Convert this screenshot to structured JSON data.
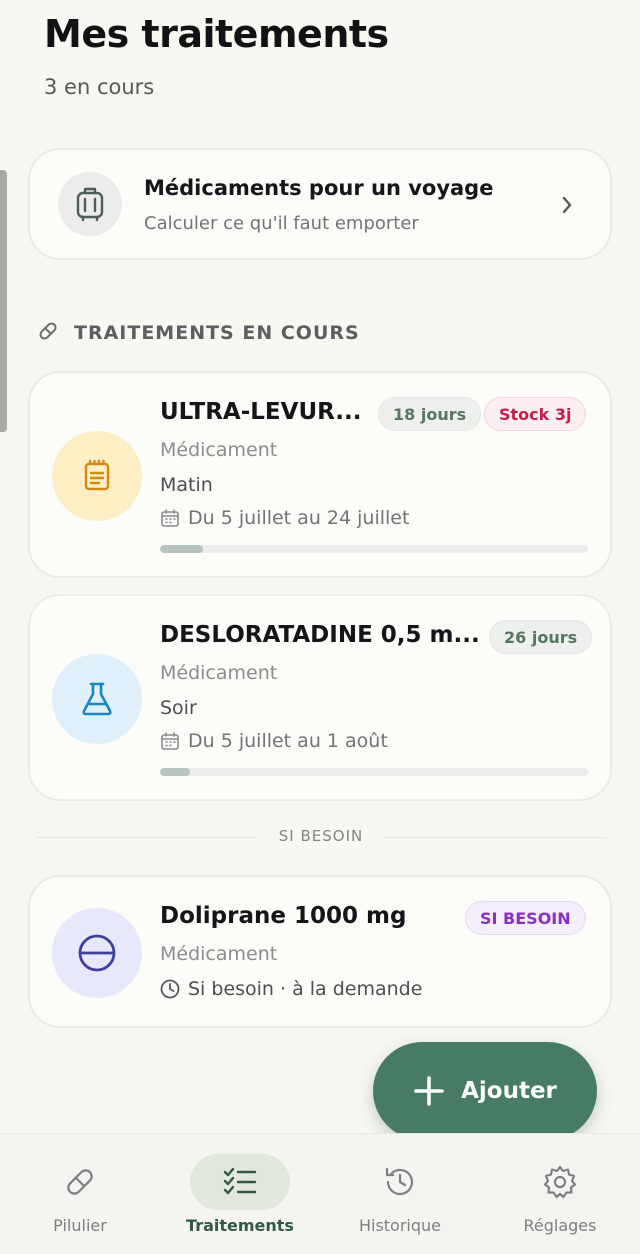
{
  "header": {
    "title": "Mes traitements",
    "subtitle": "3 en cours"
  },
  "travel_card": {
    "title": "Médicaments pour un voyage",
    "subtitle": "Calculer ce qu'il faut emporter",
    "icon": "luggage-icon"
  },
  "sections": {
    "ongoing_label": "TRAITEMENTS EN COURS",
    "as_needed_label": "SI BESOIN"
  },
  "treatments": [
    {
      "name": "ULTRA-LEVUR...",
      "type": "Médicament",
      "time": "Matin",
      "dates": "Du 5 juillet au 24 juillet",
      "days_badge": "18 jours",
      "stock_badge": "Stock 3j",
      "progress": 0.1,
      "icon": "notepad-icon"
    },
    {
      "name": "DESLORATADINE 0,5 m...",
      "type": "Médicament",
      "time": "Soir",
      "dates": "Du 5 juillet au 1 août",
      "days_badge": "26 jours",
      "progress": 0.07,
      "icon": "flask-icon"
    }
  ],
  "as_needed": {
    "name": "Doliprane 1000 mg",
    "type": "Médicament",
    "schedule": "Si besoin · à la demande",
    "badge": "SI BESOIN",
    "icon": "pill-round-icon"
  },
  "fab": {
    "label": "Ajouter"
  },
  "nav": {
    "items": [
      {
        "label": "Pilulier",
        "icon": "pill-icon",
        "active": false
      },
      {
        "label": "Traitements",
        "icon": "checklist-icon",
        "active": true
      },
      {
        "label": "Historique",
        "icon": "history-icon",
        "active": false
      },
      {
        "label": "Réglages",
        "icon": "gear-icon",
        "active": false
      }
    ]
  },
  "colors": {
    "accent": "#477b63",
    "stock_alert": "#c81d4b",
    "as_needed": "#8a2fc4"
  }
}
